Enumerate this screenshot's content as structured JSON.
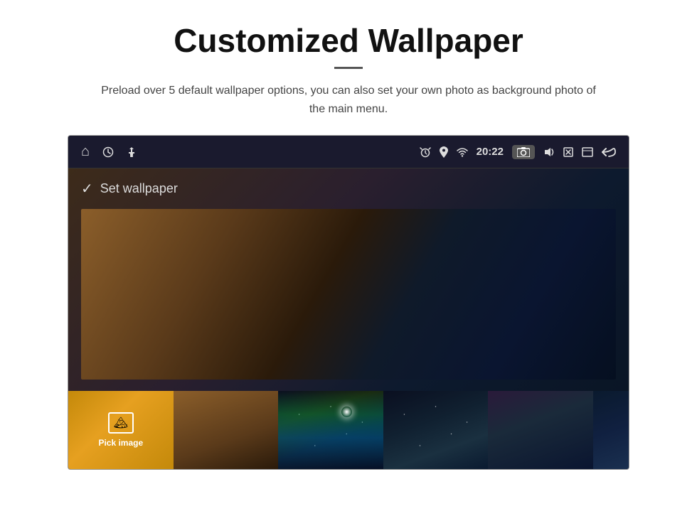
{
  "page": {
    "title": "Customized Wallpaper",
    "subtitle": "Preload over 5 default wallpaper options, you can also set your own photo as background photo of the main menu.",
    "divider_label": "—"
  },
  "device": {
    "status_bar": {
      "time": "20:22",
      "left_icons": [
        "home",
        "clock",
        "usb"
      ],
      "right_icons": [
        "alarm",
        "location",
        "wifi",
        "camera",
        "volume",
        "close",
        "window",
        "back"
      ]
    },
    "content": {
      "set_wallpaper_label": "Set wallpaper",
      "pick_image_label": "Pick image"
    }
  }
}
